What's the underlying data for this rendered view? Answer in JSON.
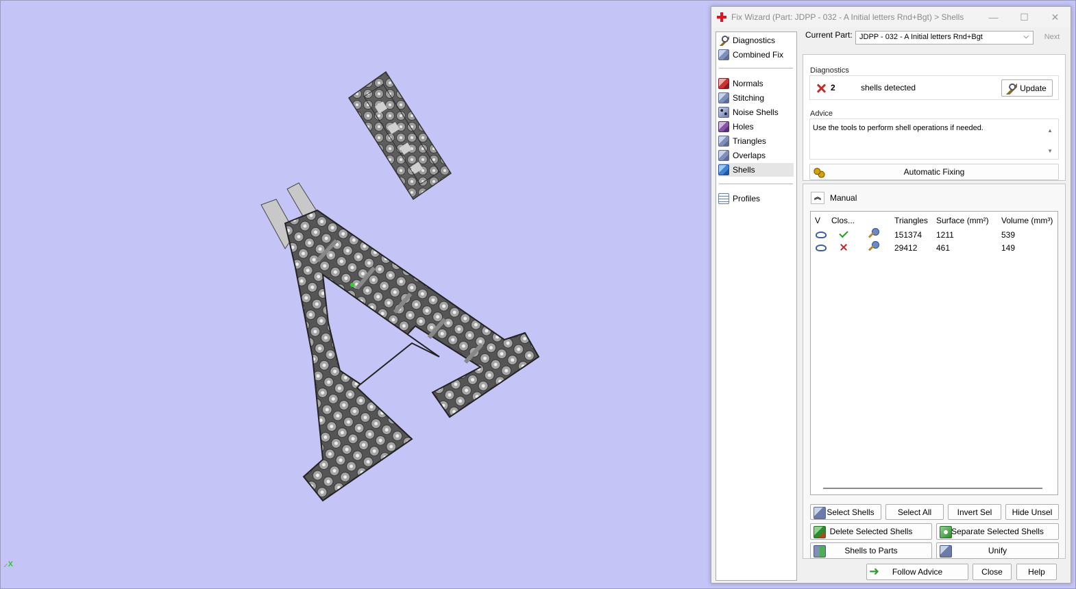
{
  "viewport": {
    "background": "#c4c4f6",
    "axis_glyph": "⸝x"
  },
  "window": {
    "title": "Fix Wizard (Part: JDPP - 032 - A Initial letters Rnd+Bgt) > Shells",
    "controls": {
      "minimize": "—",
      "maximize": "☐",
      "close": "✕"
    }
  },
  "nav": {
    "items": [
      {
        "label": "Diagnostics",
        "icon": "magnifier-icon"
      },
      {
        "label": "Combined Fix",
        "icon": "cube-icon"
      },
      {
        "label": "Normals",
        "icon": "normals-cube-icon"
      },
      {
        "label": "Stitching",
        "icon": "stitch-cube-icon"
      },
      {
        "label": "Noise Shells",
        "icon": "noise-cube-icon"
      },
      {
        "label": "Holes",
        "icon": "holes-cube-icon"
      },
      {
        "label": "Triangles",
        "icon": "triangles-cube-icon"
      },
      {
        "label": "Overlaps",
        "icon": "overlaps-cube-icon"
      },
      {
        "label": "Shells",
        "icon": "shells-cube-icon",
        "selected": true
      },
      {
        "label": "Profiles",
        "icon": "profiles-doc-icon"
      }
    ]
  },
  "current_part": {
    "label": "Current Part:",
    "value": "JDPP - 032 - A Initial letters Rnd+Bgt",
    "next": "Next"
  },
  "diagnostics": {
    "label": "Diagnostics",
    "count": "2",
    "message": "shells detected",
    "update_button": "Update"
  },
  "advice": {
    "label": "Advice",
    "text": "Use the tools to perform shell operations if needed."
  },
  "automatic_fixing": "Automatic Fixing",
  "manual": {
    "label": "Manual",
    "columns": [
      "V",
      "Clos...",
      "",
      "Triangles",
      "Surface (mm²)",
      "Volume (mm³)"
    ],
    "rows": [
      {
        "closed": true,
        "triangles": "151374",
        "surface": "1211",
        "volume": "539"
      },
      {
        "closed": false,
        "triangles": "29412",
        "surface": "461",
        "volume": "149"
      }
    ],
    "buttons": {
      "select_shells": "Select Shells",
      "select_all": "Select All",
      "invert_sel": "Invert Sel",
      "hide_unsel": "Hide Unsel",
      "delete_selected": "Delete Selected Shells",
      "separate_selected": "Separate Selected Shells",
      "shells_to_parts": "Shells to Parts",
      "unify": "Unify"
    }
  },
  "footer": {
    "follow_advice": "Follow Advice",
    "close": "Close",
    "help": "Help"
  }
}
